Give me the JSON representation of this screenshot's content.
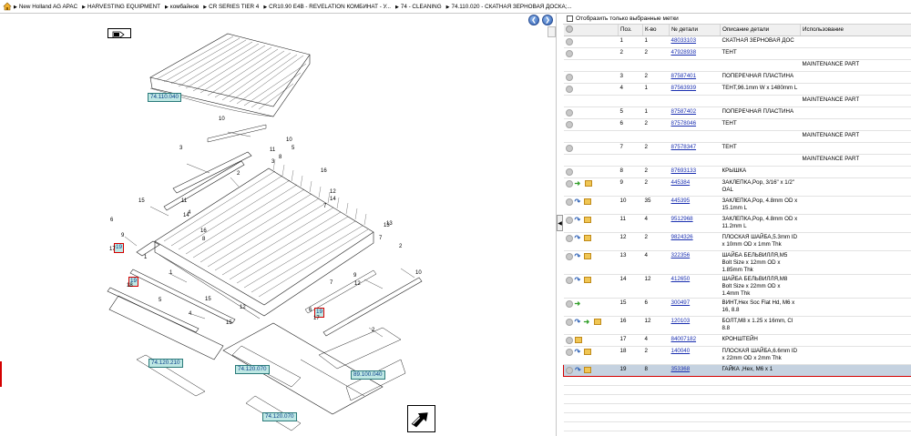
{
  "breadcrumb": [
    "New Holland AG APAC",
    "HARVESTING EQUIPMENT",
    "комбайнов",
    "CR SERIES TIER 4",
    "CR10.90 E4B - REVELATION КОМБИНАТ - У...",
    "74 - CLEANING",
    "74.110.020 - СКАТНАЯ ЗЕРНОВАЯ ДОСКА;..."
  ],
  "drawing": {
    "callouts": [
      "74.110.040",
      "74.120.210",
      "74.120.070",
      "89.100.040",
      "74.120.070"
    ],
    "highlighted_refs": [
      "19",
      "19",
      "19"
    ],
    "labels": [
      "10",
      "3",
      "2",
      "10",
      "5",
      "11",
      "8",
      "16",
      "15",
      "6",
      "17",
      "9",
      "12",
      "14",
      "7",
      "1",
      "4",
      "13",
      "18",
      "5",
      "15",
      "12",
      "6",
      "17",
      "11",
      "16",
      "3",
      "10",
      "2",
      "13",
      "9",
      "12",
      "7",
      "4",
      "15",
      "2",
      "1",
      "14",
      "8",
      "7"
    ]
  },
  "parts": {
    "filter_label": "Отобразить только выбранные метки",
    "columns": [
      "Поз.",
      "К-во",
      "№ детали",
      "Описание детали",
      "Использование"
    ],
    "rows": [
      {
        "icons": [
          "grey"
        ],
        "pos": "1",
        "qty": "1",
        "part": "48033103",
        "desc": "СКАТНАЯ ЗЕРНОВАЯ ДОС",
        "usage": ""
      },
      {
        "icons": [
          "grey"
        ],
        "pos": "2",
        "qty": "2",
        "part": "47928938",
        "desc": "ТЕНТ",
        "usage": ""
      },
      {
        "icons": [],
        "pos": "",
        "qty": "",
        "part": "",
        "desc": "",
        "usage": "MAINTENANCE PART"
      },
      {
        "icons": [
          "grey"
        ],
        "pos": "3",
        "qty": "2",
        "part": "87587401",
        "desc": "ПОПЕРЕЧНАЯ ПЛАСТИНА",
        "usage": ""
      },
      {
        "icons": [
          "grey"
        ],
        "pos": "4",
        "qty": "1",
        "part": "87563939",
        "desc": "ТЕНТ,96.1mm W x 1480mm L",
        "usage": ""
      },
      {
        "icons": [],
        "pos": "",
        "qty": "",
        "part": "",
        "desc": "",
        "usage": "MAINTENANCE PART"
      },
      {
        "icons": [
          "grey"
        ],
        "pos": "5",
        "qty": "1",
        "part": "87587402",
        "desc": "ПОПЕРЕЧНАЯ ПЛАСТИНА",
        "usage": ""
      },
      {
        "icons": [
          "grey"
        ],
        "pos": "6",
        "qty": "2",
        "part": "87578046",
        "desc": "ТЕНТ",
        "usage": ""
      },
      {
        "icons": [],
        "pos": "",
        "qty": "",
        "part": "",
        "desc": "",
        "usage": "MAINTENANCE PART"
      },
      {
        "icons": [
          "grey"
        ],
        "pos": "7",
        "qty": "2",
        "part": "87578347",
        "desc": "ТЕНТ",
        "usage": ""
      },
      {
        "icons": [],
        "pos": "",
        "qty": "",
        "part": "",
        "desc": "",
        "usage": "MAINTENANCE PART"
      },
      {
        "icons": [
          "grey"
        ],
        "pos": "8",
        "qty": "2",
        "part": "87693133",
        "desc": "КРЫШКА",
        "usage": ""
      },
      {
        "icons": [
          "grey",
          "green",
          "box"
        ],
        "pos": "9",
        "qty": "2",
        "part": "445384",
        "desc": "ЗАКЛЕПКА,Pop, 3/16\" x 1/2\" OAL",
        "usage": ""
      },
      {
        "icons": [
          "grey",
          "blue",
          "box"
        ],
        "pos": "10",
        "qty": "35",
        "part": "445395",
        "desc": "ЗАКЛЕПКА,Pop, 4.8mm OD x 15.1mm L",
        "usage": ""
      },
      {
        "icons": [
          "grey",
          "blue",
          "box"
        ],
        "pos": "11",
        "qty": "4",
        "part": "9512968",
        "desc": "ЗАКЛЕПКА,Pop, 4.8mm OD x 11.2mm L",
        "usage": ""
      },
      {
        "icons": [
          "grey",
          "blue",
          "box"
        ],
        "pos": "12",
        "qty": "2",
        "part": "9824326",
        "desc": "ПЛОСКАЯ ШАЙБА,5.3mm ID x 10mm OD x 1mm Thk",
        "usage": ""
      },
      {
        "icons": [
          "grey",
          "blue",
          "box"
        ],
        "pos": "13",
        "qty": "4",
        "part": "322356",
        "desc": "ШАЙБА БЕЛЬВИЛЛЯ,M5 Bolt Size x 12mm OD x 1.85mm Thk",
        "usage": ""
      },
      {
        "icons": [
          "grey",
          "blue",
          "box"
        ],
        "pos": "14",
        "qty": "12",
        "part": "412650",
        "desc": "ШАЙБА БЕЛЬВИЛЛЯ,M8 Bolt Size x 22mm OD x 1.4mm Thk",
        "usage": ""
      },
      {
        "icons": [
          "grey",
          "green"
        ],
        "pos": "15",
        "qty": "6",
        "part": "300497",
        "desc": "ВИНТ,Hex Soc Flat Hd, M6 x 16, 8.8",
        "usage": ""
      },
      {
        "icons": [
          "grey",
          "blue",
          "green",
          "box"
        ],
        "pos": "16",
        "qty": "12",
        "part": "120103",
        "desc": "БОЛТ,M8 x 1.25 x 16mm, Cl 8.8",
        "usage": ""
      },
      {
        "icons": [
          "grey",
          "box"
        ],
        "pos": "17",
        "qty": "4",
        "part": "84007182",
        "desc": "КРОНШТЕЙН",
        "usage": ""
      },
      {
        "icons": [
          "grey",
          "blue",
          "box"
        ],
        "pos": "18",
        "qty": "2",
        "part": "140040",
        "desc": "ПЛОСКАЯ ШАЙБА,6.6mm ID x 22mm OD x 2mm Thk",
        "usage": ""
      },
      {
        "icons": [
          "grey",
          "blue",
          "box"
        ],
        "pos": "19",
        "qty": "8",
        "part": "353368",
        "desc": "ГАЙКА ,Hex, M6 x 1",
        "usage": "",
        "selected": true
      }
    ]
  },
  "colors": {
    "link": "#1a2fb0",
    "highlight_border": "#d40000",
    "selected_row": "#c5d2e0",
    "callout_fill": "#bfe8e4"
  }
}
